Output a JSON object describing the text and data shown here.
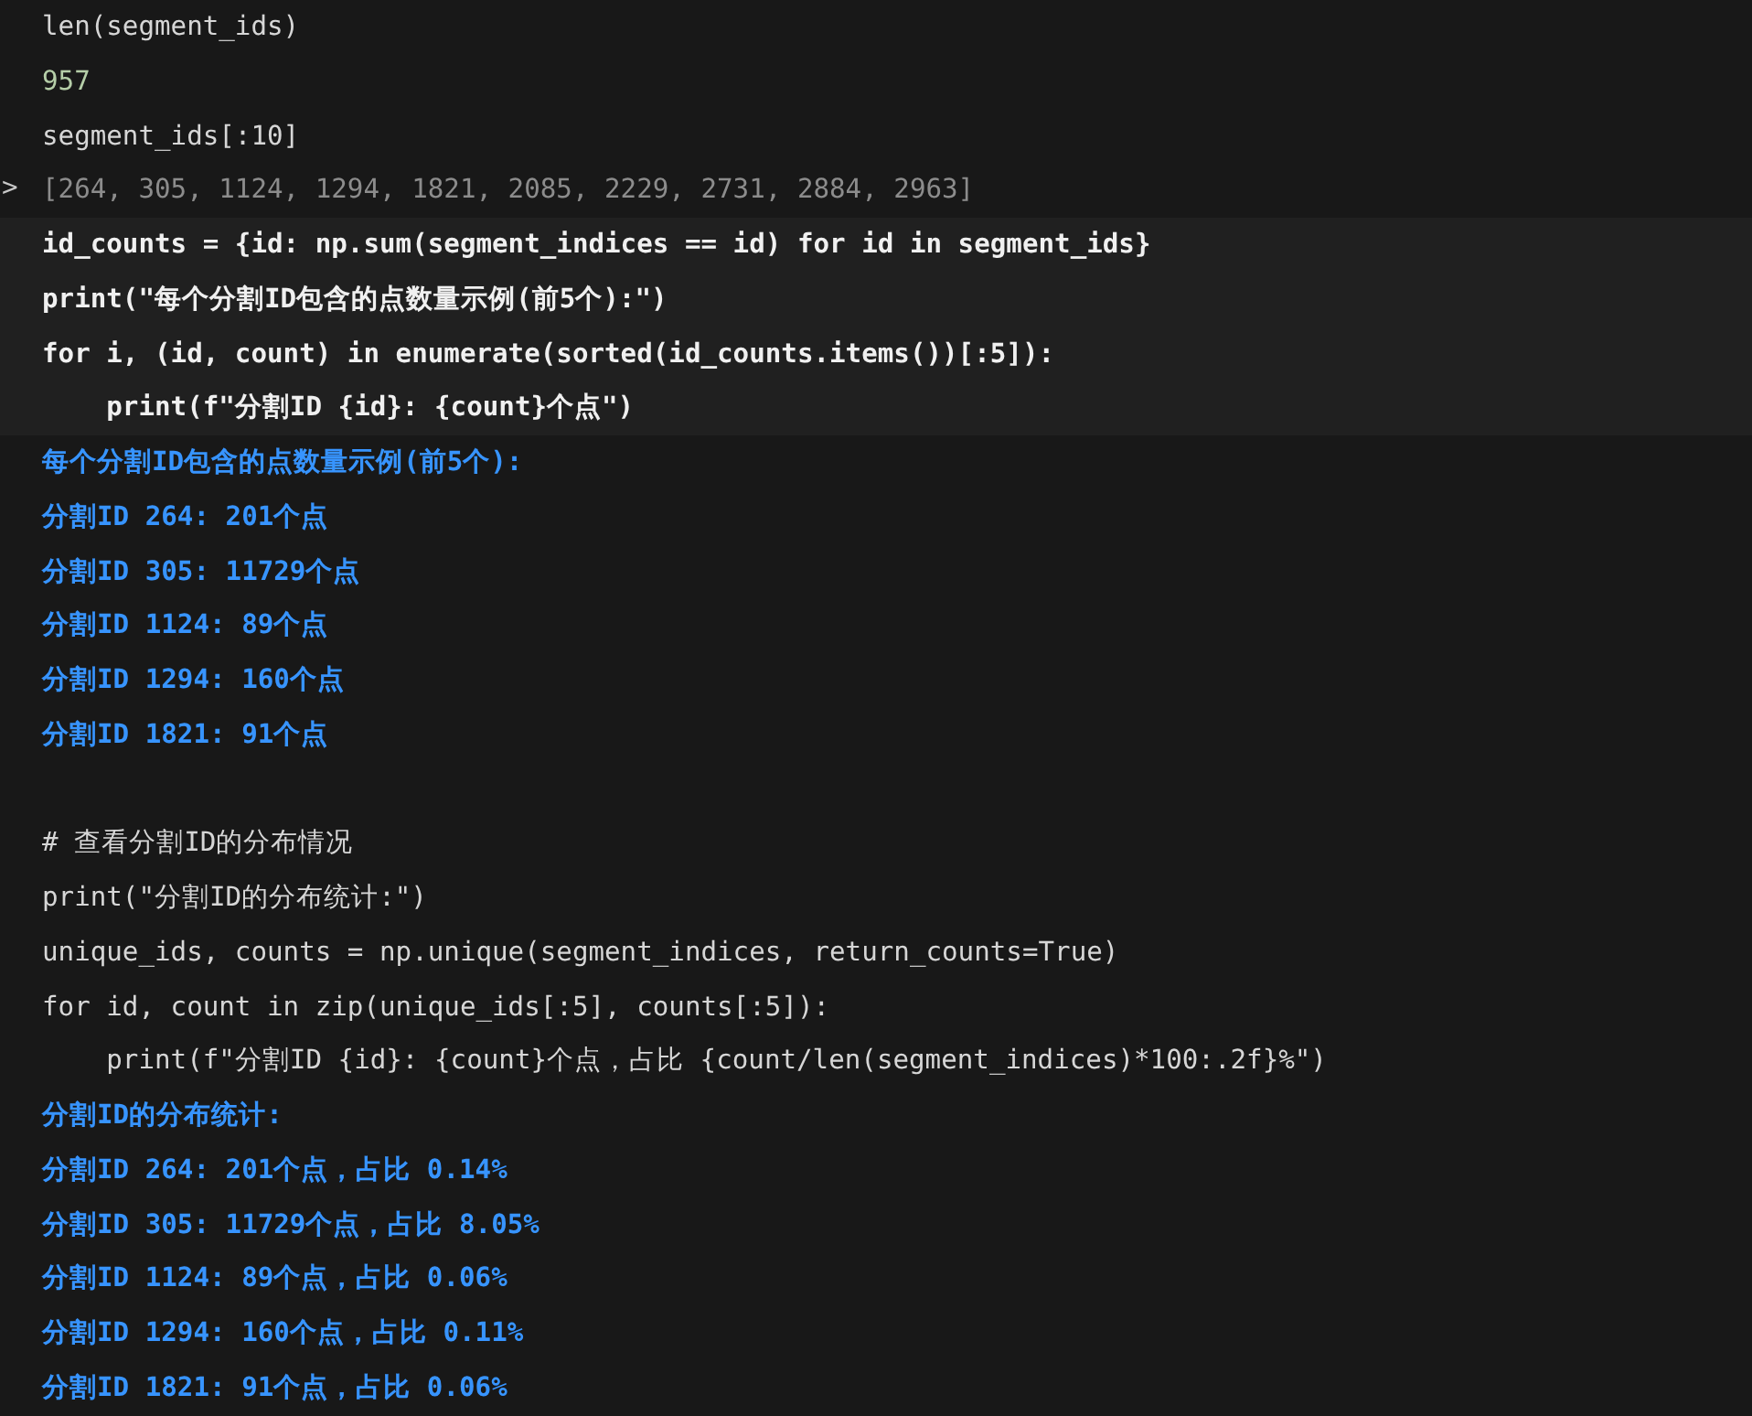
{
  "blocks": [
    {
      "kind": "code",
      "focused": false,
      "spaced": false,
      "lines": [
        "len(segment_ids)"
      ]
    },
    {
      "kind": "number",
      "lines": [
        "957"
      ]
    },
    {
      "kind": "code",
      "focused": false,
      "spaced": false,
      "lines": [
        "segment_ids[:10]"
      ]
    },
    {
      "kind": "collapsed",
      "chevron": ">",
      "lines": [
        "[264, 305, 1124, 1294, 1821, 2085, 2229, 2731, 2884, 2963]"
      ]
    },
    {
      "kind": "code",
      "focused": true,
      "spaced": false,
      "lines": [
        "id_counts = {id: np.sum(segment_indices == id) for id in segment_ids}",
        "print(\"每个分割ID包含的点数量示例(前5个):\")",
        "for i, (id, count) in enumerate(sorted(id_counts.items())[:5]):",
        "    print(f\"分割ID {id}: {count}个点\")"
      ]
    },
    {
      "kind": "stdout",
      "lines": [
        "每个分割ID包含的点数量示例(前5个):",
        "分割ID 264: 201个点",
        "分割ID 305: 11729个点",
        "分割ID 1124: 89个点",
        "分割ID 1294: 160个点",
        "分割ID 1821: 91个点"
      ]
    },
    {
      "kind": "code",
      "focused": false,
      "spaced": true,
      "lines": [
        "# 查看分割ID的分布情况",
        "print(\"分割ID的分布统计:\")",
        "unique_ids, counts = np.unique(segment_indices, return_counts=True)",
        "for id, count in zip(unique_ids[:5], counts[:5]):",
        "    print(f\"分割ID {id}: {count}个点，占比 {count/len(segment_indices)*100:.2f}%\")"
      ]
    },
    {
      "kind": "stdout",
      "lines": [
        "分割ID的分布统计:",
        "分割ID 264: 201个点，占比 0.14%",
        "分割ID 305: 11729个点，占比 8.05%",
        "分割ID 1124: 89个点，占比 0.06%",
        "分割ID 1294: 160个点，占比 0.11%",
        "分割ID 1821: 91个点，占比 0.06%"
      ]
    }
  ]
}
